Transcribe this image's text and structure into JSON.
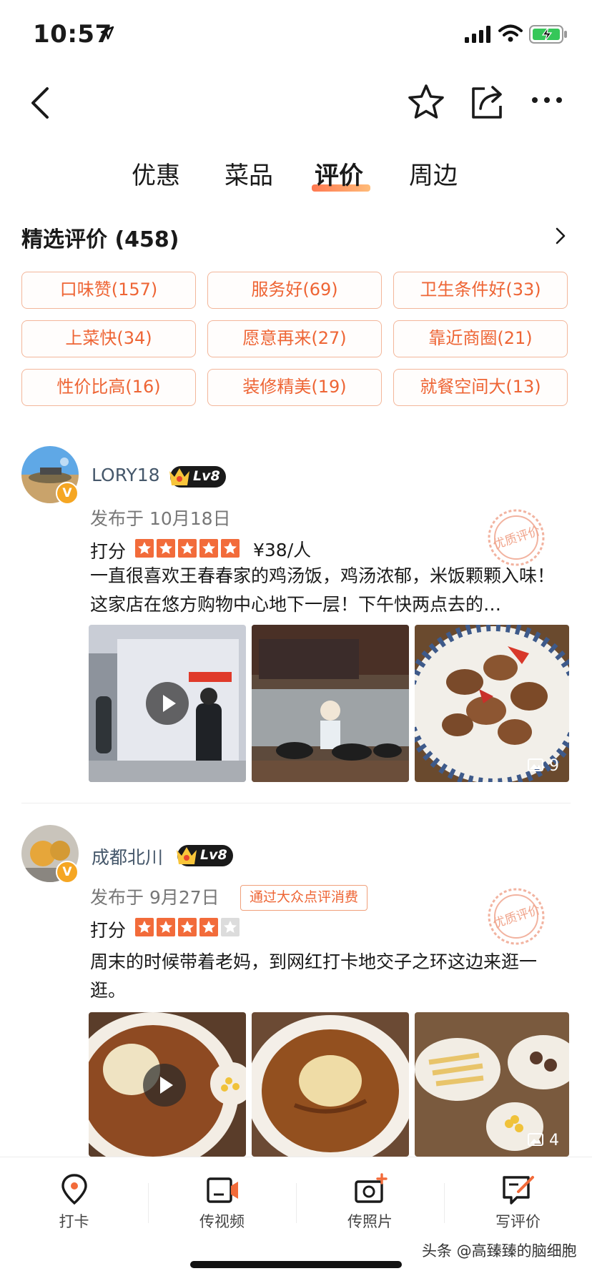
{
  "status_bar": {
    "time": "10:57"
  },
  "tabs": [
    {
      "label": "优惠",
      "active": false
    },
    {
      "label": "菜品",
      "active": false
    },
    {
      "label": "评价",
      "active": true
    },
    {
      "label": "周边",
      "active": false
    }
  ],
  "section": {
    "title": "精选评价 (458)"
  },
  "tags": [
    "口味赞(157)",
    "服务好(69)",
    "卫生条件好(33)",
    "上菜快(34)",
    "愿意再来(27)",
    "靠近商圈(21)",
    "性价比高(16)",
    "装修精美(19)",
    "就餐空间大(13)"
  ],
  "reviews": [
    {
      "user": "LORY18",
      "level": "Lv8",
      "verified_badge": "V",
      "date": "发布于 10月18日",
      "score_label": "打分",
      "stars": 5,
      "price": "¥38/人",
      "text": "一直很喜欢王春春家的鸡汤饭，鸡汤浓郁，米饭颗颗入味！这家店在悠方购物中心地下一层！下午快两点去的…",
      "photo_count": "9",
      "stamp": "优质评价"
    },
    {
      "user": "成都北川",
      "level": "Lv8",
      "verified_badge": "V",
      "date": "发布于 9月27日",
      "consume_badge": "通过大众点评消费",
      "score_label": "打分",
      "stars": 4,
      "text": "周末的时候带着老妈，到网红打卡地交子之环这边来逛一逛。",
      "photo_count": "4",
      "stamp": "优质评价"
    }
  ],
  "bottom_bar": [
    {
      "label": "打卡",
      "icon": "location-pin-icon"
    },
    {
      "label": "传视频",
      "icon": "video-upload-icon"
    },
    {
      "label": "传照片",
      "icon": "camera-plus-icon"
    },
    {
      "label": "写评价",
      "icon": "write-review-icon"
    }
  ],
  "watermark": "头条 @高臻臻的脑细胞",
  "colors": {
    "accent": "#ee6535",
    "star": "#f26b3a",
    "tag_border": "#f3b69a"
  }
}
